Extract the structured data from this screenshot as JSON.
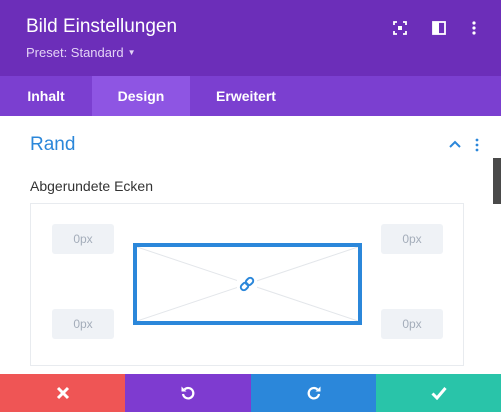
{
  "header": {
    "title": "Bild Einstellungen",
    "preset_label": "Preset: Standard",
    "icons": [
      "fullscreen-icon",
      "sidebar-layout-icon",
      "more-vertical-icon"
    ]
  },
  "tabs": [
    {
      "label": "Inhalt",
      "active": false
    },
    {
      "label": "Design",
      "active": true
    },
    {
      "label": "Erweitert",
      "active": false
    }
  ],
  "section": {
    "title": "Rand",
    "field_label": "Abgerundete Ecken",
    "corners": {
      "top_left": "0px",
      "top_right": "0px",
      "bottom_left": "0px",
      "bottom_right": "0px"
    }
  },
  "footer": {
    "buttons": [
      "cancel",
      "undo",
      "redo",
      "save"
    ]
  },
  "colors": {
    "header_bg": "#6c2eb9",
    "tabs_bg": "#7b3fd0",
    "active_tab_bg": "#8e55e3",
    "accent_blue": "#2b87da",
    "cancel_red": "#ef5555",
    "undo_purple": "#7e3bd0",
    "redo_blue": "#2b87da",
    "save_green": "#29c4a9"
  }
}
